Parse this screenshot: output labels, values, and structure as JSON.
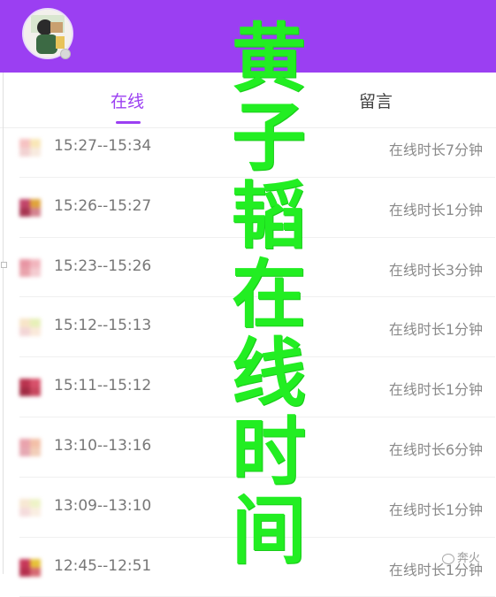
{
  "header": {
    "avatar_icon": "user-photo-avatar-icon",
    "background_color": "#9b3ff2"
  },
  "tabs": [
    {
      "label": "在线",
      "active": true
    },
    {
      "label": "留言",
      "active": false
    }
  ],
  "sessions": [
    {
      "time": "15:27--15:34",
      "duration": "在线时长7分钟",
      "icon_colors": [
        "#f6c2c2",
        "#f9e7b7",
        "#f2d2d2",
        "#f8eadf"
      ]
    },
    {
      "time": "15:26--15:27",
      "duration": "在线时长1分钟",
      "icon_colors": [
        "#c2456a",
        "#e0a43c",
        "#a73552",
        "#d4838f"
      ]
    },
    {
      "time": "15:23--15:26",
      "duration": "在线时长3分钟",
      "icon_colors": [
        "#e896a4",
        "#f2b6be",
        "#e9a3ac",
        "#f4cbd0"
      ]
    },
    {
      "time": "15:12--15:13",
      "duration": "在线时长1分钟",
      "icon_colors": [
        "#f7e5c8",
        "#e7f0b8",
        "#f3d6d6",
        "#fae9da"
      ]
    },
    {
      "time": "15:11--15:12",
      "duration": "在线时长1分钟",
      "icon_colors": [
        "#b9334f",
        "#d8516b",
        "#a22c44",
        "#c8485f"
      ]
    },
    {
      "time": "13:10--13:16",
      "duration": "在线时长6分钟",
      "icon_colors": [
        "#e9a3ad",
        "#f3c0a8",
        "#e6a8b2",
        "#f2cdb8"
      ]
    },
    {
      "time": "13:09--13:10",
      "duration": "在线时长1分钟",
      "icon_colors": [
        "#f7e8d3",
        "#eef3c7",
        "#f5dcdc",
        "#faeee2"
      ]
    },
    {
      "time": "12:45--12:51",
      "duration": "在线时长1分钟",
      "icon_colors": [
        "#c7385a",
        "#e7c23a",
        "#b5304e",
        "#d66a73"
      ]
    }
  ],
  "overlay": {
    "characters": [
      "黄",
      "子",
      "韬",
      "在",
      "线",
      "时",
      "间"
    ],
    "color": "#22ee22"
  },
  "watermark": {
    "text": "奔火",
    "icon": "wechat-logo-icon"
  }
}
